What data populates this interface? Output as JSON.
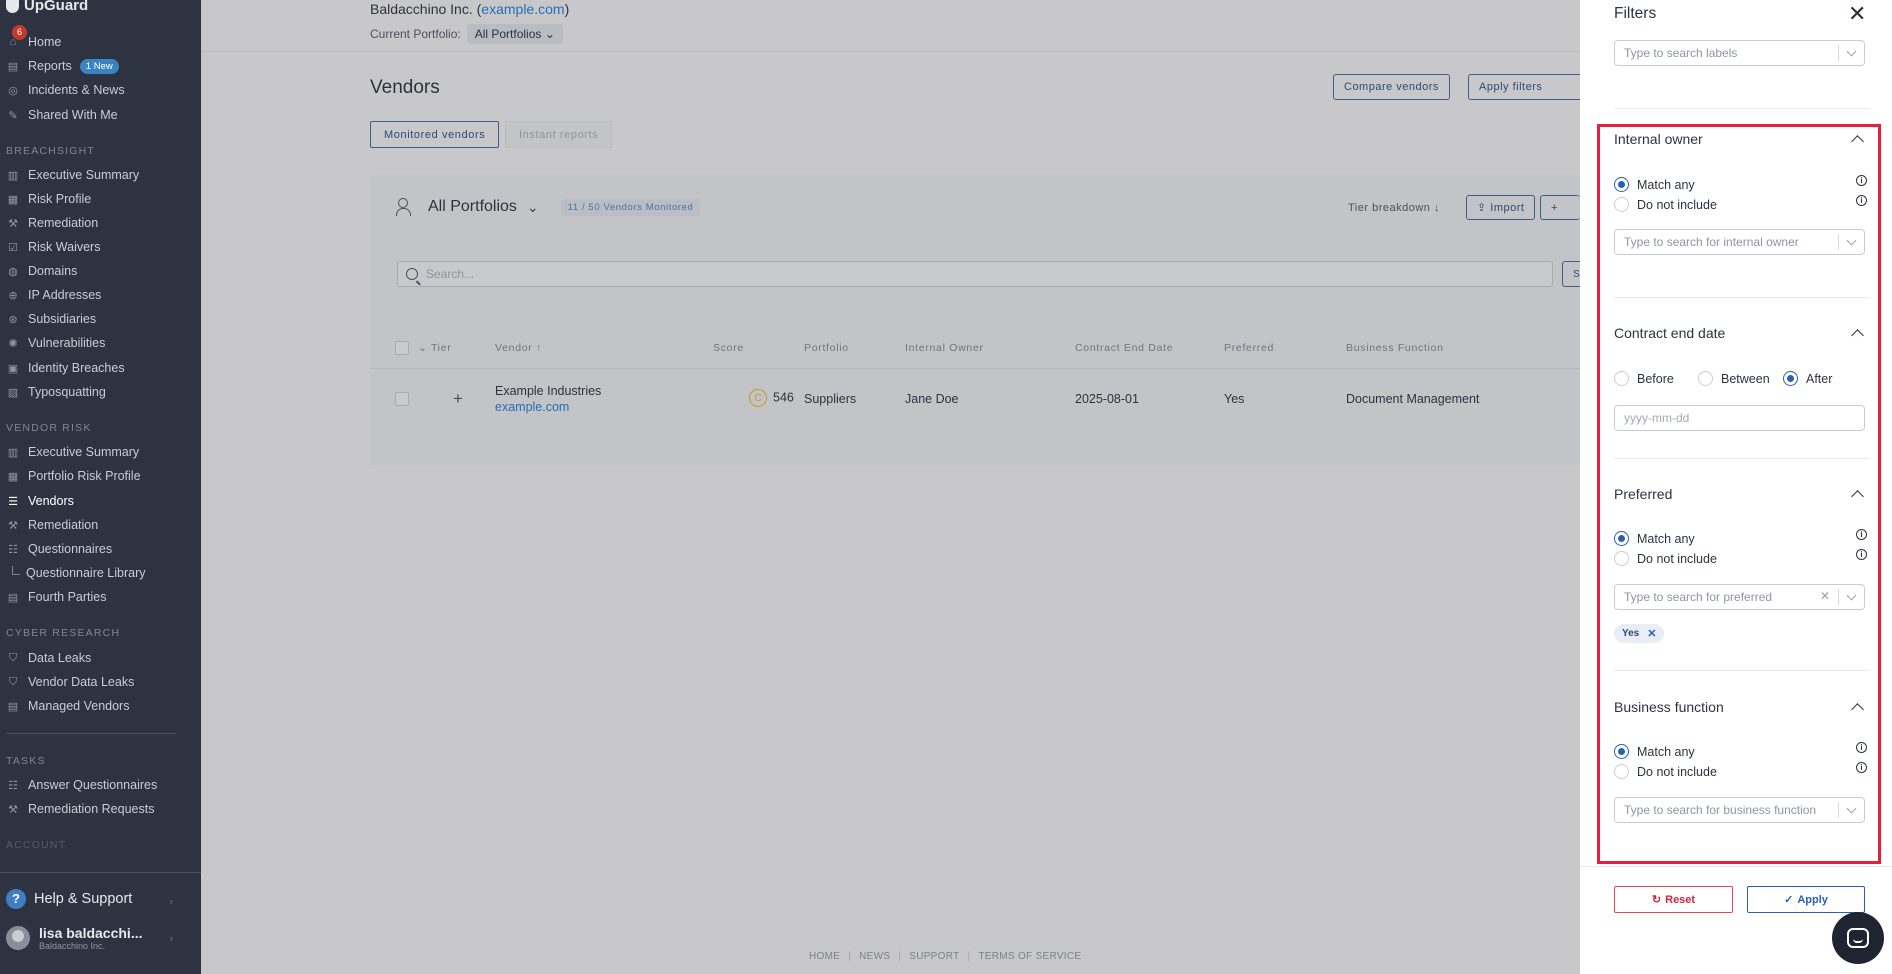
{
  "sidebar": {
    "brand": "UpGuard",
    "notification_count": "6",
    "items_top": [
      {
        "label": "Home",
        "icon": "home-icon"
      },
      {
        "label": "Reports",
        "icon": "report-icon",
        "badge": "1 New"
      },
      {
        "label": "Incidents & News",
        "icon": "news-icon"
      },
      {
        "label": "Shared With Me",
        "icon": "shared-icon"
      }
    ],
    "breachsight_title": "BREACHSIGHT",
    "breachsight": [
      "Executive Summary",
      "Risk Profile",
      "Remediation",
      "Risk Waivers",
      "Domains",
      "IP Addresses",
      "Subsidiaries",
      "Vulnerabilities",
      "Identity Breaches",
      "Typosquatting"
    ],
    "vendor_risk_title": "VENDOR RISK",
    "vendor_risk": [
      "Executive Summary",
      "Portfolio Risk Profile",
      "Vendors",
      "Remediation",
      "Questionnaires",
      "Questionnaire Library",
      "Fourth Parties"
    ],
    "cyber_research_title": "CYBER RESEARCH",
    "cyber_research": [
      "Data Leaks",
      "Vendor Data Leaks",
      "Managed Vendors"
    ],
    "tasks_title": "TASKS",
    "tasks": [
      "Answer Questionnaires",
      "Remediation Requests"
    ],
    "account_title": "ACCOUNT",
    "help": "Help & Support",
    "user_name": "lisa baldacchi...",
    "user_org": "Baldacchino Inc."
  },
  "header": {
    "org": "Baldacchino Inc.",
    "domain": "example.com",
    "portfolio_label": "Current Portfolio:",
    "portfolio_value": "All Portfolios"
  },
  "main": {
    "title": "Vendors",
    "compare_btn": "Compare vendors",
    "apply_filters_btn": "Apply filters",
    "tab_monitored": "Monitored vendors",
    "tab_instant": "Instant reports",
    "card_title": "All Portfolios",
    "monitored_count": "11 / 50 Vendors Monitored",
    "tier_breakdown": "Tier breakdown",
    "import_btn": "Import",
    "search_placeholder": "Search...",
    "columns": [
      "Tier",
      "Vendor",
      "Score",
      "Portfolio",
      "Internal Owner",
      "Contract End Date",
      "Preferred",
      "Business Function"
    ],
    "row": {
      "vendor": "Example Industries",
      "domain": "example.com",
      "grade": "C",
      "score": "546",
      "portfolio": "Suppliers",
      "owner": "Jane Doe",
      "end_date": "2025-08-01",
      "preferred": "Yes",
      "function": "Document Management"
    },
    "footer": [
      "HOME",
      "NEWS",
      "SUPPORT",
      "TERMS OF SERVICE"
    ]
  },
  "filters": {
    "title": "Filters",
    "labels_placeholder": "Type to search labels",
    "internal_owner": {
      "title": "Internal owner",
      "match_any": "Match any",
      "do_not_include": "Do not include",
      "placeholder": "Type to search for internal owner"
    },
    "contract_end": {
      "title": "Contract end date",
      "before": "Before",
      "between": "Between",
      "after": "After",
      "date_placeholder": "yyyy-mm-dd"
    },
    "preferred": {
      "title": "Preferred",
      "match_any": "Match any",
      "do_not_include": "Do not include",
      "placeholder": "Type to search for preferred",
      "chip": "Yes"
    },
    "business_function": {
      "title": "Business function",
      "match_any": "Match any",
      "do_not_include": "Do not include",
      "placeholder": "Type to search for business function"
    },
    "reset": "Reset",
    "apply": "Apply"
  },
  "colors": {
    "sidebar_bg": "#2d3340",
    "accent": "#2a5fb8",
    "highlight": "#e51f3f",
    "reset": "#d0263e"
  }
}
